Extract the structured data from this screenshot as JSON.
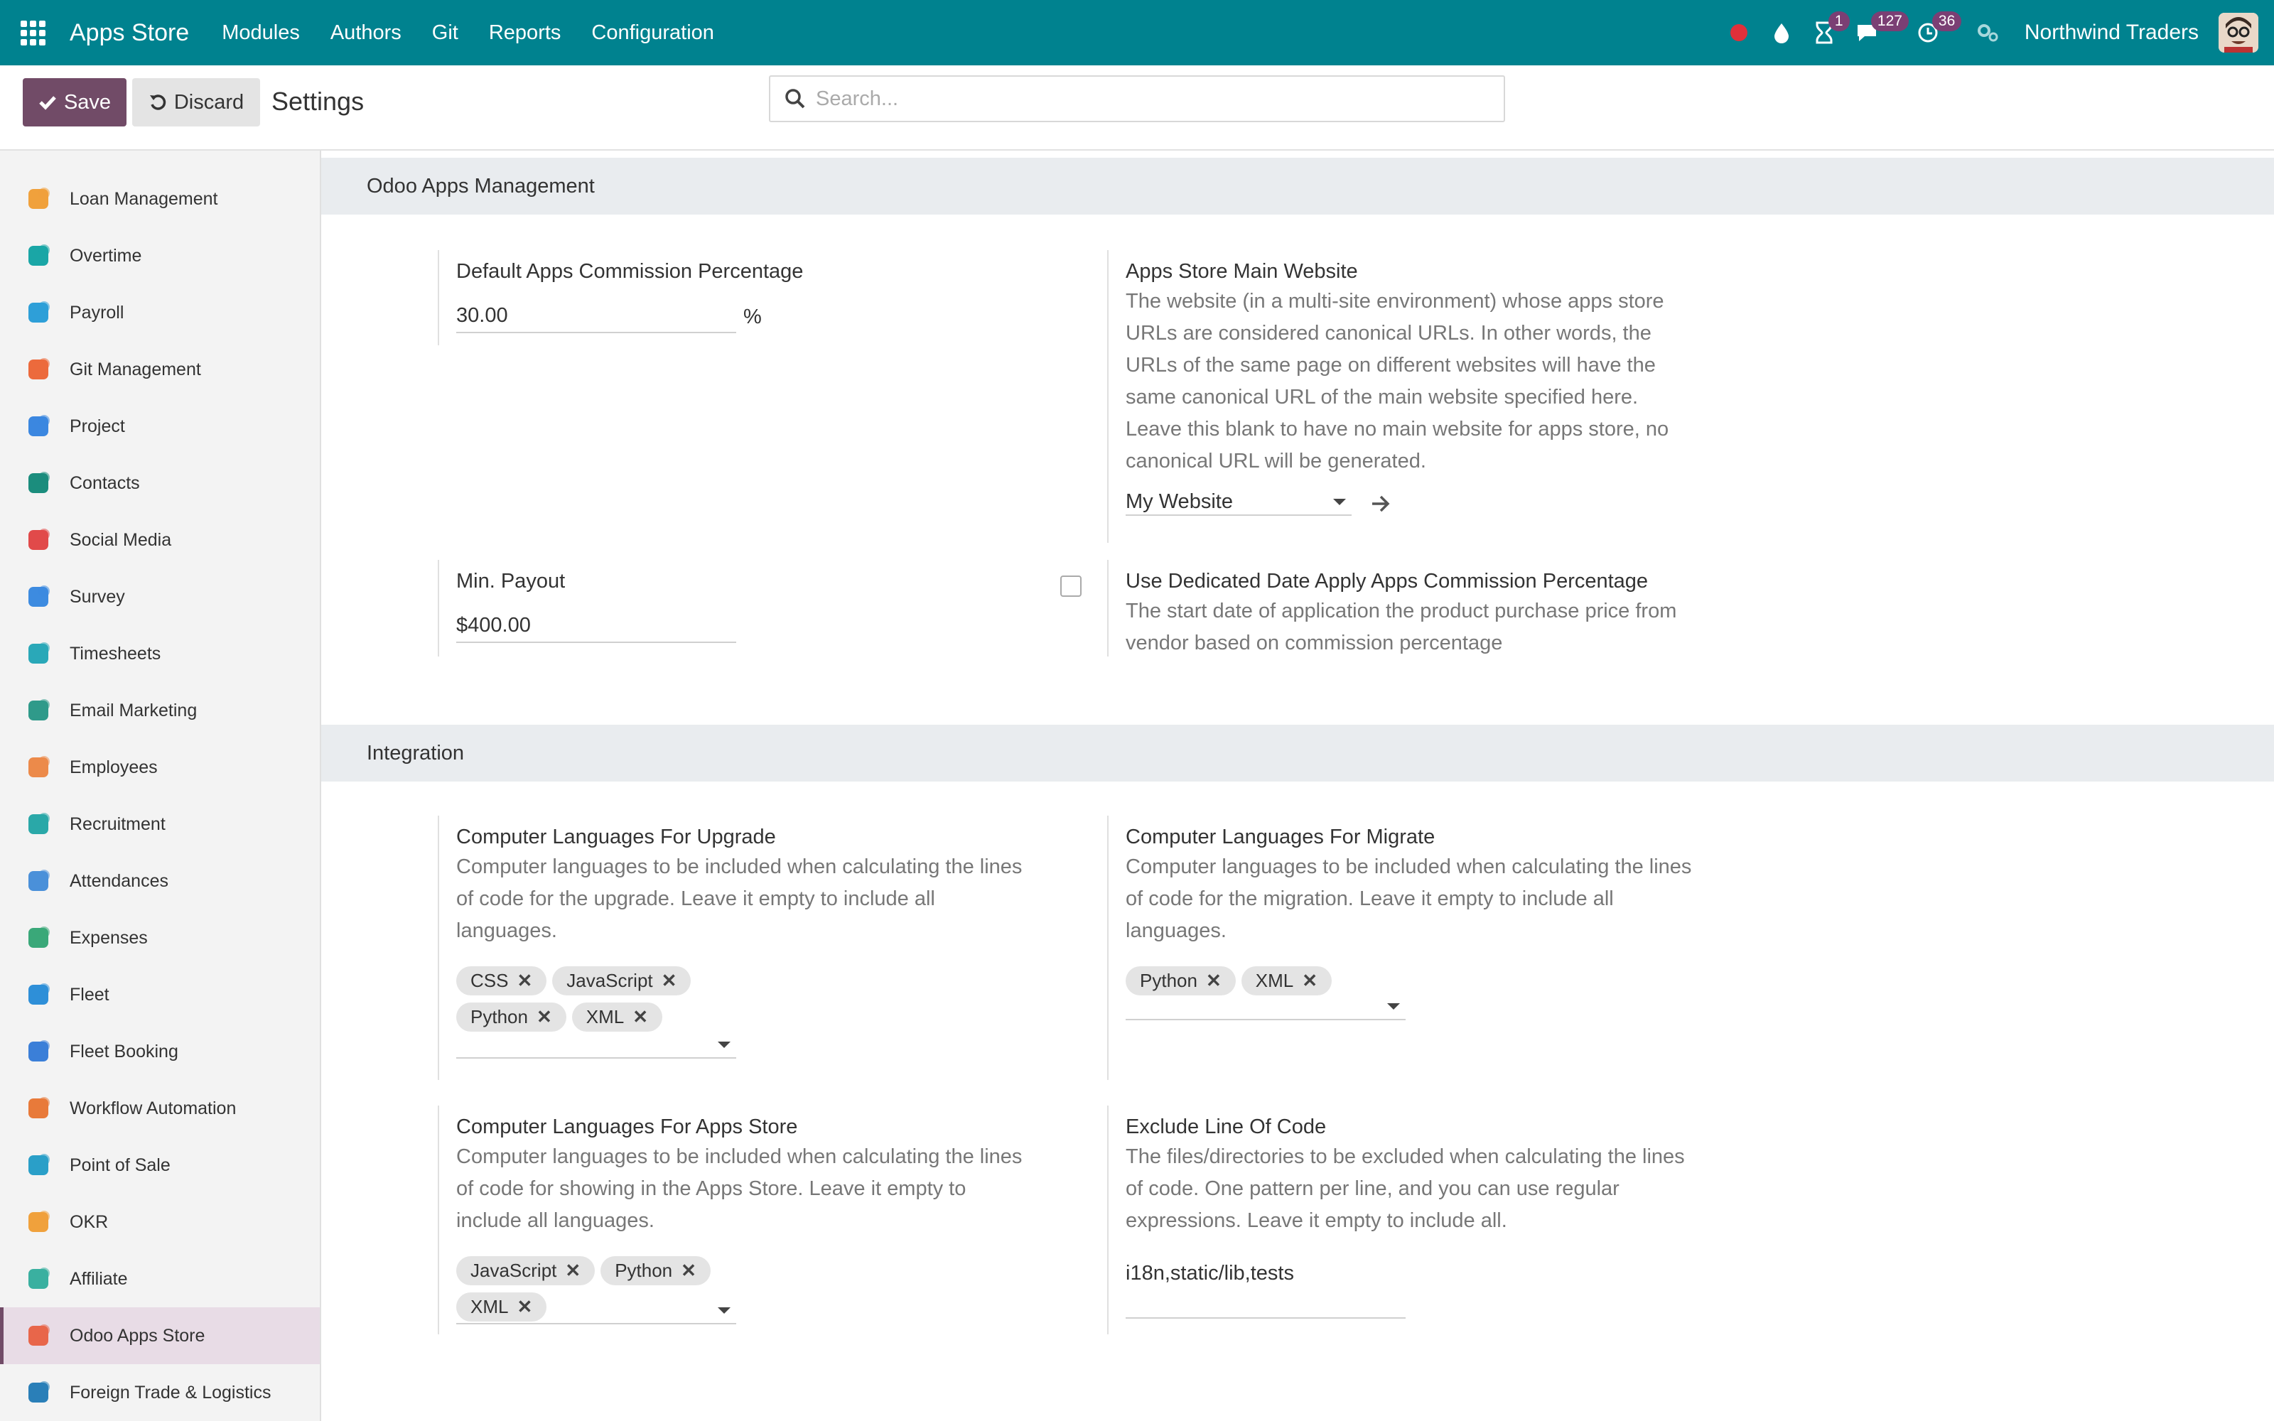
{
  "navbar": {
    "brand": "Apps Store",
    "menu": [
      "Modules",
      "Authors",
      "Git",
      "Reports",
      "Configuration"
    ],
    "badges": {
      "activity": "1",
      "messages": "127",
      "timesheet": "36"
    },
    "company": "Northwind Traders"
  },
  "control": {
    "save_label": "Save",
    "discard_label": "Discard",
    "breadcrumb": "Settings",
    "search_placeholder": "Search..."
  },
  "sidebar": {
    "items": [
      {
        "label": "Loan Management",
        "icon": "loan-icon",
        "color": "#f0a13c"
      },
      {
        "label": "Overtime",
        "icon": "clock-icon",
        "color": "#1aa6a6"
      },
      {
        "label": "Payroll",
        "icon": "payroll-icon",
        "color": "#2e9fd8"
      },
      {
        "label": "Git Management",
        "icon": "git-icon",
        "color": "#ec6a3c"
      },
      {
        "label": "Project",
        "icon": "rocket-icon",
        "color": "#3b87e0"
      },
      {
        "label": "Contacts",
        "icon": "contacts-icon",
        "color": "#1b8d7d"
      },
      {
        "label": "Social Media",
        "icon": "megaphone-icon",
        "color": "#e14a4a"
      },
      {
        "label": "Survey",
        "icon": "survey-icon",
        "color": "#3d8be0"
      },
      {
        "label": "Timesheets",
        "icon": "timesheet-icon",
        "color": "#2aa8b8"
      },
      {
        "label": "Email Marketing",
        "icon": "paper-plane-icon",
        "color": "#2f9a8a"
      },
      {
        "label": "Employees",
        "icon": "employees-icon",
        "color": "#ec8a4a"
      },
      {
        "label": "Recruitment",
        "icon": "recruitment-icon",
        "color": "#2aa8a8"
      },
      {
        "label": "Attendances",
        "icon": "attendance-icon",
        "color": "#4a90d9"
      },
      {
        "label": "Expenses",
        "icon": "expenses-icon",
        "color": "#3aa879"
      },
      {
        "label": "Fleet",
        "icon": "car-icon",
        "color": "#2e8fd8"
      },
      {
        "label": "Fleet Booking",
        "icon": "calendar-icon",
        "color": "#3b7fd8"
      },
      {
        "label": "Workflow Automation",
        "icon": "workflow-icon",
        "color": "#e87a3a"
      },
      {
        "label": "Point of Sale",
        "icon": "pos-icon",
        "color": "#2a9fc8"
      },
      {
        "label": "OKR",
        "icon": "okr-icon",
        "color": "#f0a13c"
      },
      {
        "label": "Affiliate",
        "icon": "affiliate-icon",
        "color": "#3ab0a0"
      },
      {
        "label": "Odoo Apps Store",
        "icon": "apps-store-icon",
        "color": "#e8664a"
      },
      {
        "label": "Foreign Trade & Logistics",
        "icon": "globe-icon",
        "color": "#2a7fb8"
      }
    ],
    "active_index": 20
  },
  "sections": {
    "apps_management": "Odoo Apps Management",
    "integration": "Integration"
  },
  "settings": {
    "commission": {
      "label": "Default Apps Commission Percentage",
      "value": "30.00",
      "unit": "%"
    },
    "main_website": {
      "label": "Apps Store Main Website",
      "desc": "The website (in a multi-site environment) whose apps store URLs are considered canonical URLs. In other words, the URLs of the same page on different websites will have the same canonical URL of the main website specified here. Leave this blank to have no main website for apps store, no canonical URL will be generated.",
      "value": "My Website"
    },
    "min_payout": {
      "label": "Min. Payout",
      "value": "$400.00"
    },
    "dedicated_date": {
      "label": "Use Dedicated Date Apply Apps Commission Percentage",
      "desc": "The start date of application the product purchase price from vendor based on commission percentage",
      "checked": false
    },
    "lang_upgrade": {
      "label": "Computer Languages For Upgrade",
      "desc": "Computer languages to be included when calculating the lines of code for the upgrade. Leave it empty to include all languages.",
      "tags": [
        "CSS",
        "JavaScript",
        "Python",
        "XML"
      ]
    },
    "lang_migrate": {
      "label": "Computer Languages For Migrate",
      "desc": "Computer languages to be included when calculating the lines of code for the migration. Leave it empty to include all languages.",
      "tags": [
        "Python",
        "XML"
      ]
    },
    "lang_store": {
      "label": "Computer Languages For Apps Store",
      "desc": "Computer languages to be included when calculating the lines of code for showing in the Apps Store. Leave it empty to include all languages.",
      "tags": [
        "JavaScript",
        "Python",
        "XML"
      ]
    },
    "exclude_loc": {
      "label": "Exclude Line Of Code",
      "desc": "The files/directories to be excluded when calculating the lines of code. One pattern per line, and you can use regular expressions. Leave it empty to include all.",
      "value": "i18n,static/lib,tests"
    }
  },
  "colors": {
    "navbar": "#00828f",
    "primary": "#714b67",
    "badge": "#7b3f74"
  }
}
